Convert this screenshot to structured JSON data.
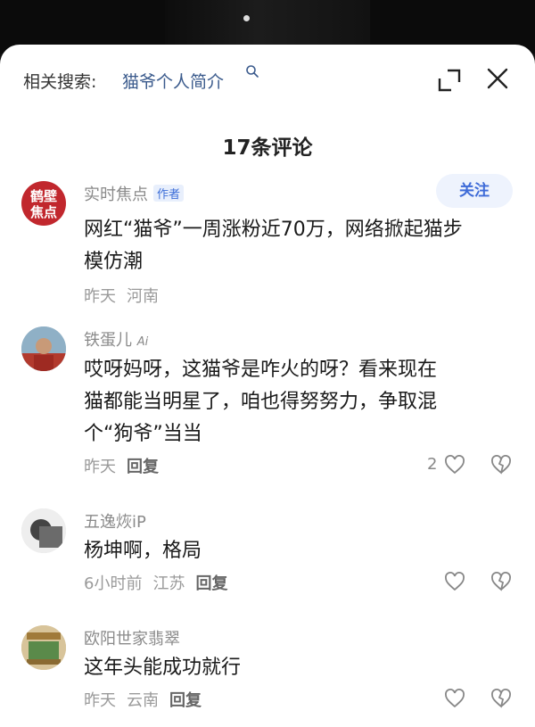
{
  "search": {
    "label": "相关搜索:",
    "term": "猫爷个人简介"
  },
  "title": "17条评论",
  "follow_label": "关注",
  "reply_label": "回复",
  "colors": {
    "accent": "#3e6bd8",
    "author_avatar": "#c1272d"
  },
  "comments": [
    {
      "name": "实时焦点",
      "badge": "作者",
      "avatar_text": "鹤壁焦点",
      "text_line1": "网红“猫爷”一周涨粉近70万，网络掀起猫步",
      "text_line2": "模仿潮",
      "time": "昨天",
      "location": "河南"
    },
    {
      "name": "铁蛋儿",
      "name_tag": "Ai",
      "text_line1": "哎呀妈呀，这猫爷是咋火的呀？看来现在",
      "text_line2": "猫都能当明星了，咱也得努努力，争取混",
      "text_line3": "个“狗爷”当当",
      "time": "昨天",
      "likes": "2"
    },
    {
      "name": "五逸烣iP",
      "text_line1": "杨坤啊，格局",
      "time": "6小时前",
      "location": "江苏"
    },
    {
      "name": "欧阳世家翡翠",
      "text_line1": "这年头能成功就行",
      "time": "昨天",
      "location": "云南"
    }
  ]
}
